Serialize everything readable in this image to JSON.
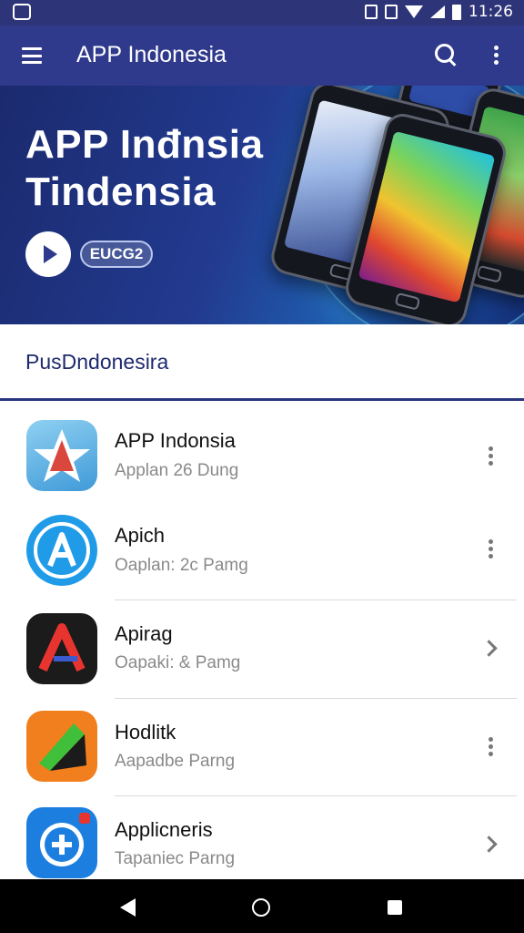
{
  "status_bar": {
    "time": "11:26"
  },
  "app_bar": {
    "title": "APP Indonesia"
  },
  "hero": {
    "title_line1": "APP Inđnsia",
    "title_line2": "Tindensia",
    "pill_label": "EUCG2"
  },
  "section": {
    "title": "PusDndonesira"
  },
  "apps": [
    {
      "name": "APP Indonsia",
      "subtitle": "Applan 26 Dung",
      "action": "more",
      "icon": "star-a-app-icon",
      "icon_colors": [
        "#5ab4e6",
        "#d9473d"
      ]
    },
    {
      "name": "Apich",
      "subtitle": "Oaplan: 2c Pamg",
      "action": "more",
      "icon": "blue-a-app-icon",
      "icon_colors": [
        "#1f9be8",
        "#ffffff"
      ]
    },
    {
      "name": "Apirag",
      "subtitle": "Oapaki: & Pamg",
      "action": "chevron",
      "icon": "red-a-app-icon",
      "icon_colors": [
        "#1b1b1b",
        "#e8342f"
      ]
    },
    {
      "name": "Hodlitk",
      "subtitle": "Aapadbe Parng",
      "action": "more",
      "icon": "green-arrow-app-icon",
      "icon_colors": [
        "#f27f1d",
        "#3fbf3a"
      ]
    },
    {
      "name": "Applicneris",
      "subtitle": "Tapaniec Parng",
      "action": "chevron",
      "icon": "plus-app-icon",
      "icon_colors": [
        "#1c7fe0",
        "#ffffff"
      ]
    }
  ]
}
